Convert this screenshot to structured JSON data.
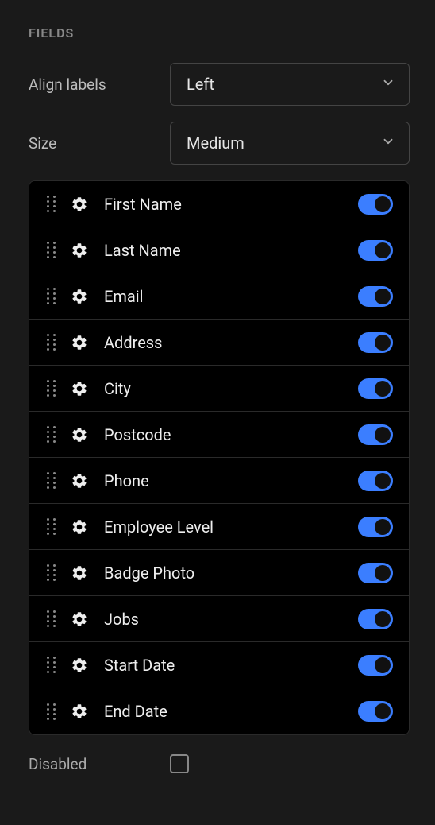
{
  "section": {
    "title": "FIELDS"
  },
  "form": {
    "align_labels": {
      "label": "Align labels",
      "value": "Left"
    },
    "size": {
      "label": "Size",
      "value": "Medium"
    }
  },
  "fields": [
    {
      "label": "First Name",
      "enabled": true
    },
    {
      "label": "Last Name",
      "enabled": true
    },
    {
      "label": "Email",
      "enabled": true
    },
    {
      "label": "Address",
      "enabled": true
    },
    {
      "label": "City",
      "enabled": true
    },
    {
      "label": "Postcode",
      "enabled": true
    },
    {
      "label": "Phone",
      "enabled": true
    },
    {
      "label": "Employee Level",
      "enabled": true
    },
    {
      "label": "Badge Photo",
      "enabled": true
    },
    {
      "label": "Jobs",
      "enabled": true
    },
    {
      "label": "Start Date",
      "enabled": true
    },
    {
      "label": "End Date",
      "enabled": true
    }
  ],
  "disabled": {
    "label": "Disabled",
    "checked": false
  }
}
